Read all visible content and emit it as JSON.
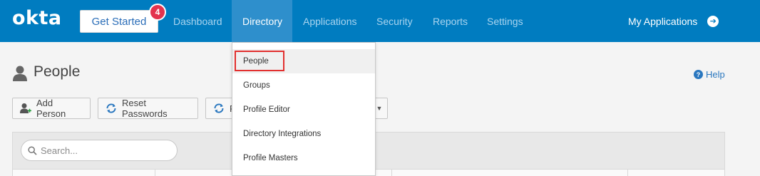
{
  "nav": {
    "logo": "okta",
    "get_started": "Get Started",
    "get_started_badge": "4",
    "items": [
      {
        "label": "Dashboard",
        "active": false
      },
      {
        "label": "Directory",
        "active": true
      },
      {
        "label": "Applications",
        "active": false
      },
      {
        "label": "Security",
        "active": false
      },
      {
        "label": "Reports",
        "active": false
      },
      {
        "label": "Settings",
        "active": false
      }
    ],
    "my_applications": "My Applications",
    "my_applications_icon": "arrow-right-circle-icon"
  },
  "page": {
    "title": "People",
    "title_icon": "person-icon",
    "help": "Help",
    "help_icon": "question-circle-icon"
  },
  "toolbar": {
    "add_person": "Add Person",
    "add_person_icon": "add-person-icon",
    "reset_passwords": "Reset Passwords",
    "reset_passwords_icon": "refresh-icon",
    "third_button_partial": "R",
    "third_button_icon": "refresh-icon",
    "more_icon": "caret-down-icon"
  },
  "search": {
    "placeholder": "Search..."
  },
  "directory_menu": {
    "items": [
      {
        "label": "People",
        "hovered": true
      },
      {
        "label": "Groups",
        "hovered": false
      },
      {
        "label": "Profile Editor",
        "hovered": false
      },
      {
        "label": "Directory Integrations",
        "hovered": false
      },
      {
        "label": "Profile Masters",
        "hovered": false
      }
    ]
  },
  "colors": {
    "nav_bg": "#007cc0",
    "nav_active": "#2e8fcc",
    "badge": "#e3334e",
    "link": "#2a77bf",
    "annotation_box": "#e2302f"
  }
}
